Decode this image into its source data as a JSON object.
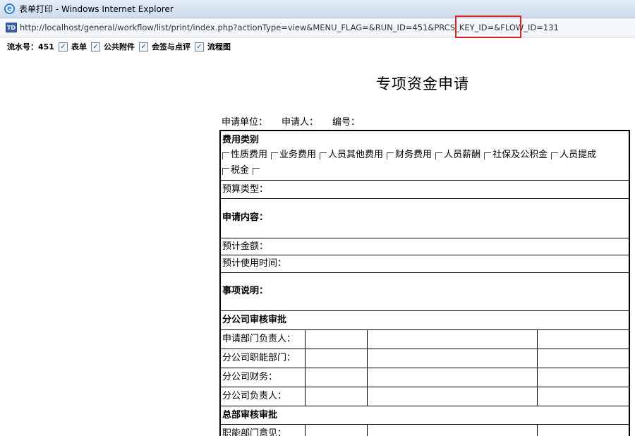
{
  "window": {
    "title": "表单打印 - Windows Internet Explorer"
  },
  "address": {
    "url": "http://localhost/general/workflow/list/print/index.php?actionType=view&MENU_FLAG=&RUN_ID=451&PRCS_KEY_ID=&FLOW_ID=131"
  },
  "options": {
    "run_id_label": "流水号：451",
    "items": [
      "表单",
      "公共附件",
      "会签与点评",
      "流程图"
    ]
  },
  "document": {
    "title": "专项资金申请",
    "meta": [
      "申请单位：",
      "申请人：",
      "编号："
    ],
    "expense_category": {
      "label": "费用类别",
      "options": [
        "性质费用",
        "业务费用",
        "人员其他费用",
        "财务费用",
        "人员薪酬",
        "社保及公积金",
        "人员提成",
        "税金",
        ""
      ]
    },
    "budget_type_label": "预算类型：",
    "apply_content_label": "申请内容：",
    "estimated_amount_label": "预计金额：",
    "estimated_time_label": "预计使用时间：",
    "matter_desc_label": "事项说明：",
    "branch_section": {
      "label": "分公司审核审批",
      "rows": [
        "申请部门负责人：",
        "分公司职能部门：",
        "分公司财务：",
        "分公司负责人："
      ]
    },
    "hq_section": {
      "label": "总部审核审批",
      "rows": [
        "职能部门意见："
      ]
    }
  }
}
